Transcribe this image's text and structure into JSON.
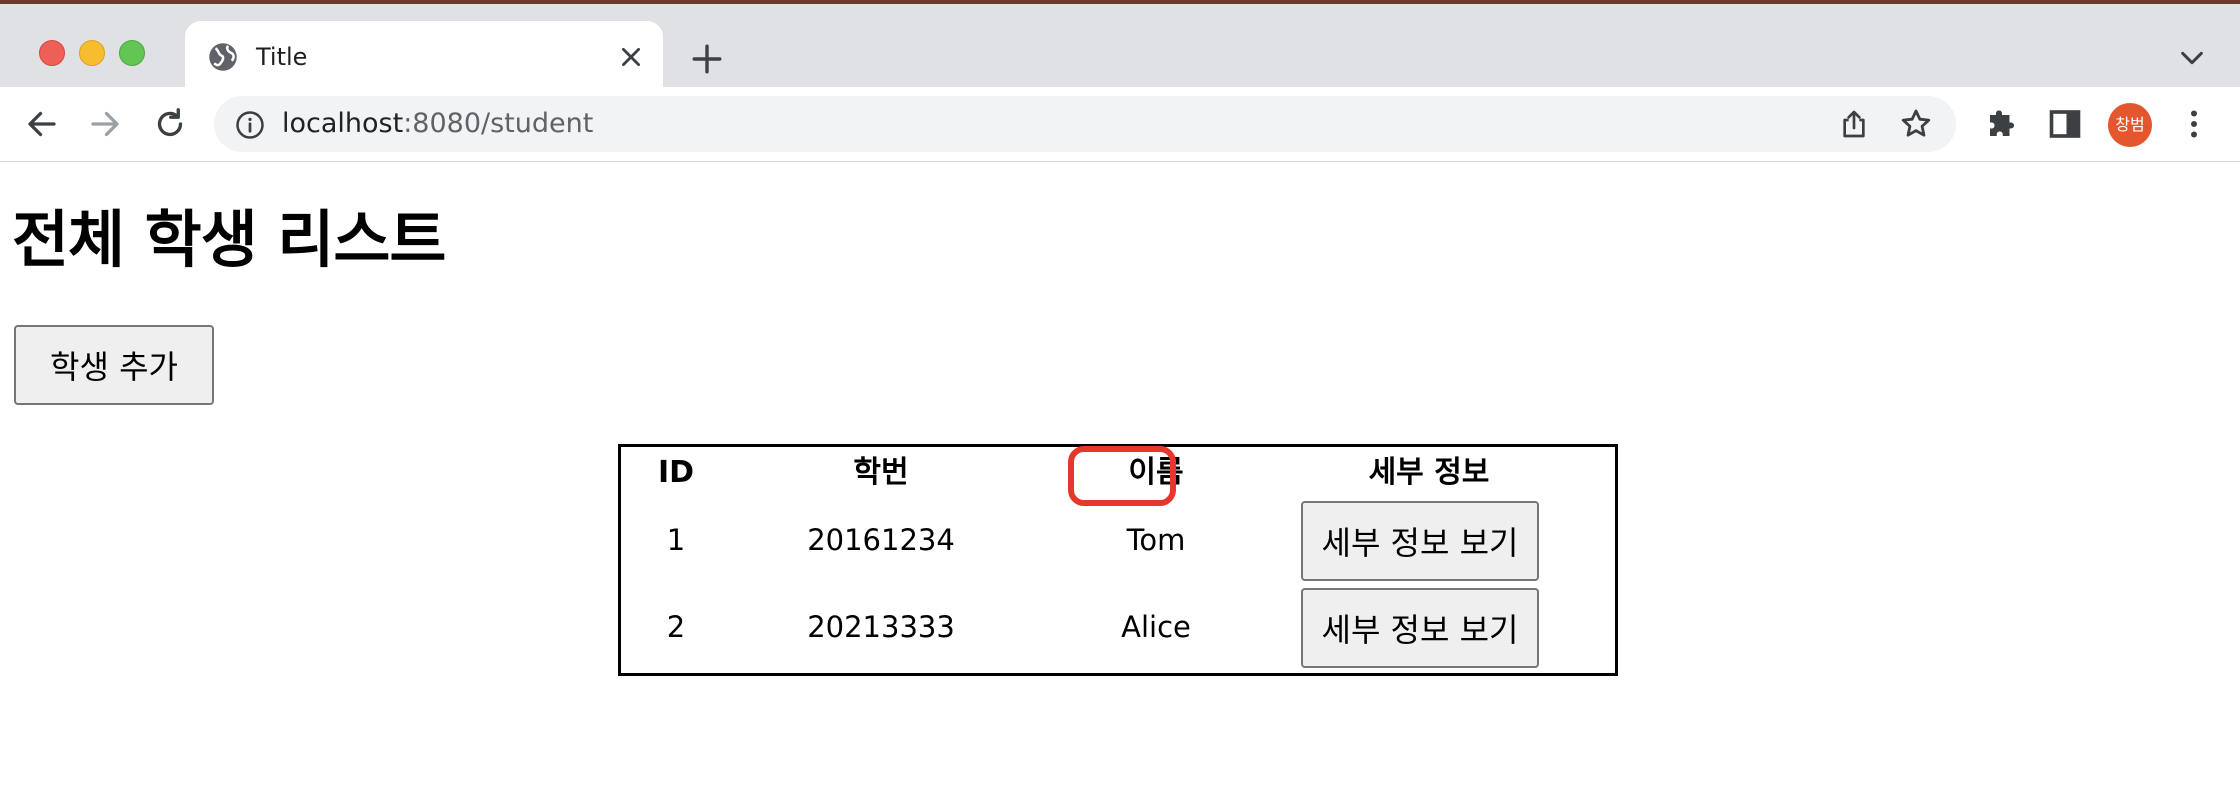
{
  "browser": {
    "tab": {
      "title": "Title"
    },
    "address": {
      "host": "localhost",
      "rest": ":8080/student"
    },
    "profile": {
      "initials": "창범",
      "color": "#e4572e"
    }
  },
  "page": {
    "title": "전체 학생 리스트",
    "add_button_label": "학생 추가",
    "table": {
      "headers": [
        "ID",
        "학번",
        "이름",
        "세부 정보"
      ],
      "rows": [
        {
          "id": "1",
          "student_number": "20161234",
          "name": "Tom",
          "action_label": "세부 정보 보기"
        },
        {
          "id": "2",
          "student_number": "20213333",
          "name": "Alice",
          "action_label": "세부 정보 보기"
        }
      ]
    }
  },
  "annotation": {
    "highlight_color": "#e5382b",
    "highlighted_header": "이름"
  }
}
